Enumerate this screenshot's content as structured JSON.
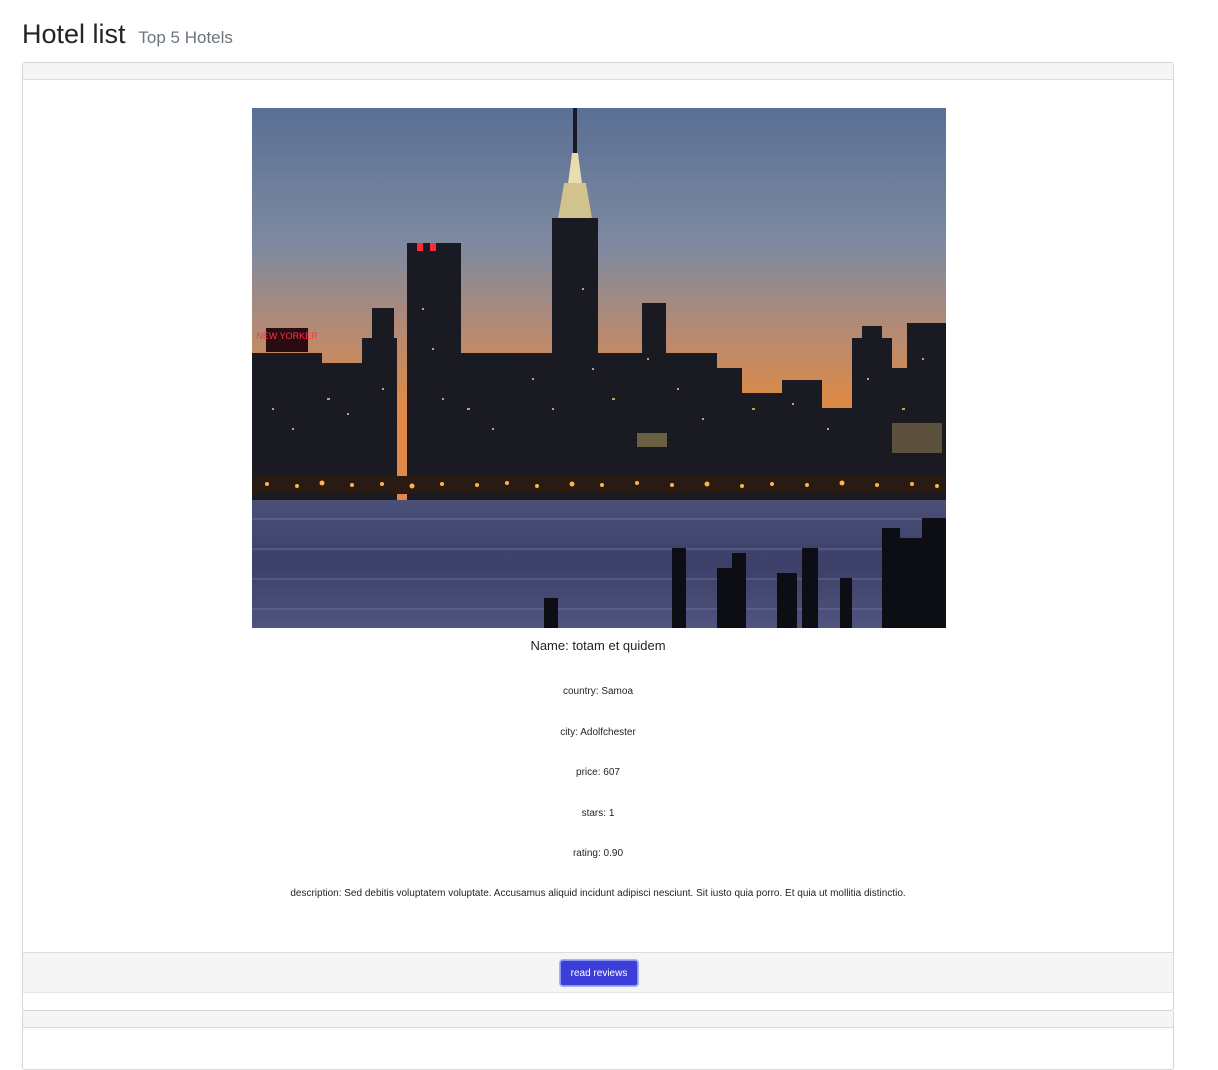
{
  "header": {
    "title": "Hotel list",
    "subtitle": "Top 5 Hotels"
  },
  "hotel": {
    "image_icon": "city-skyline-photo",
    "name": "Name: totam et quidem",
    "country": "country: Samoa",
    "city": "city: Adolfchester",
    "price": "price: 607",
    "stars": "stars: 1",
    "rating": "rating: 0.90",
    "description": "description: Sed debitis voluptatem voluptate. Accusamus aliquid incidunt adipisci nesciunt. Sit iusto quia porro. Et quia ut mollitia distinctio.",
    "photo_sign": "NEW YORKER",
    "read_reviews_label": "read reviews"
  },
  "colors": {
    "button_bg": "#3b3fd8",
    "card_header_bg": "#f5f5f5",
    "subtitle": "#6c757d"
  }
}
